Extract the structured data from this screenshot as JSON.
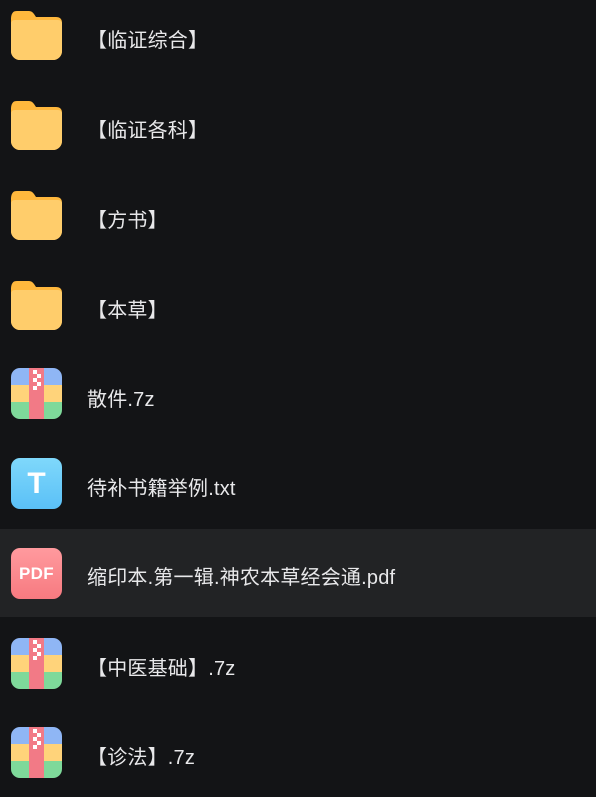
{
  "files": [
    {
      "name": "【临证综合】",
      "type": "folder",
      "icon": "folder-icon"
    },
    {
      "name": "【临证各科】",
      "type": "folder",
      "icon": "folder-icon"
    },
    {
      "name": "【方书】",
      "type": "folder",
      "icon": "folder-icon"
    },
    {
      "name": "【本草】",
      "type": "folder",
      "icon": "folder-icon"
    },
    {
      "name": "散件.7z",
      "type": "archive",
      "icon": "archive-icon"
    },
    {
      "name": "待补书籍举例.txt",
      "type": "text",
      "icon": "text-file-icon",
      "icon_text": "T"
    },
    {
      "name": "缩印本.第一辑.神农本草经会通.pdf",
      "type": "pdf",
      "icon": "pdf-file-icon",
      "icon_text": "PDF",
      "selected": true
    },
    {
      "name": "【中医基础】.7z",
      "type": "archive",
      "icon": "archive-icon"
    },
    {
      "name": "【诊法】.7z",
      "type": "archive",
      "icon": "archive-icon"
    }
  ],
  "colors": {
    "background": "#131416",
    "selected_row": "#222325",
    "text": "#e8e8ea",
    "folder": "#ffc65c",
    "txt_icon": "#6ccbf9",
    "pdf_icon": "#ff8a8f"
  }
}
